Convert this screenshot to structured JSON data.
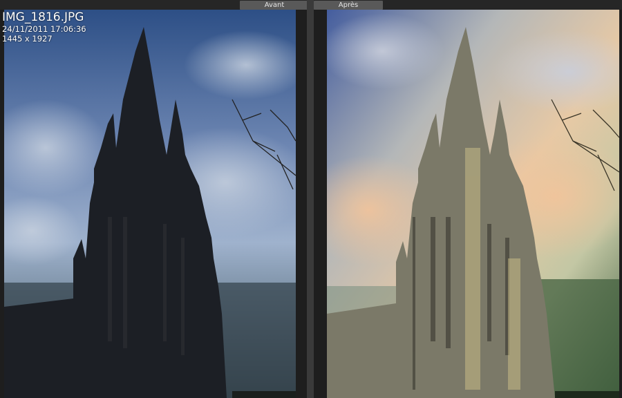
{
  "views": {
    "before_label": "Avant",
    "after_label": "Après"
  },
  "photo_info": {
    "filename": "IMG_1816.JPG",
    "datetime": "24/11/2011 17:06:36",
    "dimensions": "1445 x 1927"
  },
  "colors": {
    "background": "#262626",
    "label_bg": "#595959",
    "label_text": "#e6e6e6",
    "overlay_text": "#ffffff"
  }
}
